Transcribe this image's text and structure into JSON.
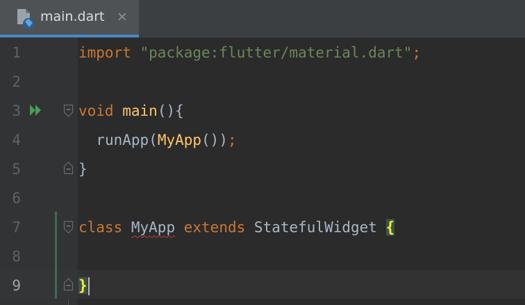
{
  "tabs": [
    {
      "label": "main.dart",
      "active": true,
      "icon": "dart-file-icon",
      "close_glyph": "✕"
    }
  ],
  "colors": {
    "accent_tab_underline": "#4a88c7",
    "keyword": "#cc7832",
    "string": "#6a8759",
    "function": "#ffc66d",
    "identifier": "#a9b7c6",
    "run_icon": "#499c54"
  },
  "editor": {
    "current_line": 9,
    "line_numbers": [
      "1",
      "2",
      "3",
      "4",
      "5",
      "6",
      "7",
      "8",
      "9"
    ],
    "lines": {
      "l1": {
        "kw": "import",
        "sp": " ",
        "str": "\"package:flutter/material.dart\"",
        "semi": ";"
      },
      "l3": {
        "kw": "void",
        "sp": " ",
        "fn": "main",
        "punct": "(){"
      },
      "l4": {
        "indent": "  ",
        "call": "runApp",
        "open": "(",
        "cls": "MyApp",
        "args": "()",
        "close": ")",
        "semi": ";"
      },
      "l5": {
        "punct": "}"
      },
      "l7": {
        "kw1": "class",
        "sp1": " ",
        "name": "MyApp",
        "sp2": " ",
        "kw2": "extends",
        "sp3": " ",
        "base": "StatefulWidget",
        "sp4": " ",
        "brace": "{"
      },
      "l9": {
        "brace": "}"
      }
    },
    "gutter_icons": {
      "run_line": 3,
      "fold_lines": [
        3,
        5,
        7,
        9
      ]
    }
  }
}
